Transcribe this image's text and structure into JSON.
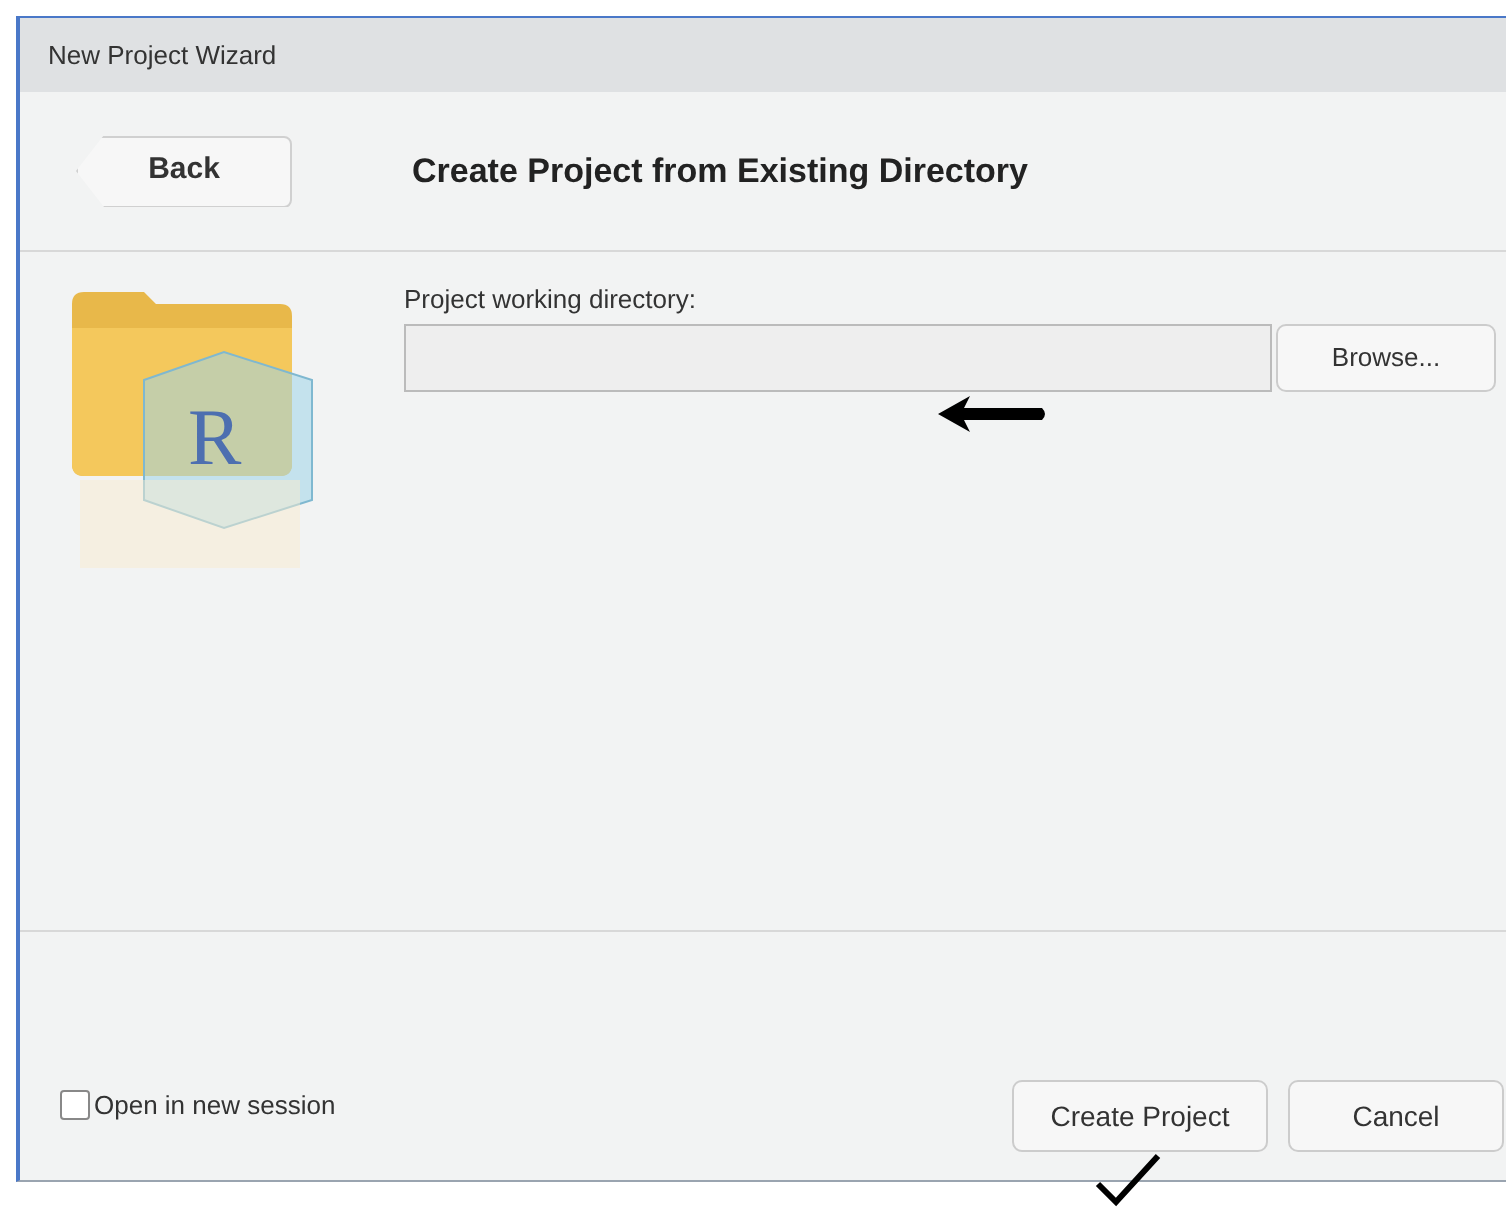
{
  "window": {
    "title": "New Project Wizard"
  },
  "header": {
    "back_button": "Back",
    "title": "Create Project from Existing Directory"
  },
  "logo": {
    "letter": "R"
  },
  "directory": {
    "label": "Project working directory:",
    "browse_button": "Browse..."
  },
  "options": [
    {
      "label": "Open in new session",
      "checked": false
    }
  ],
  "buttons": [
    "Create Project",
    "Cancel"
  ]
}
